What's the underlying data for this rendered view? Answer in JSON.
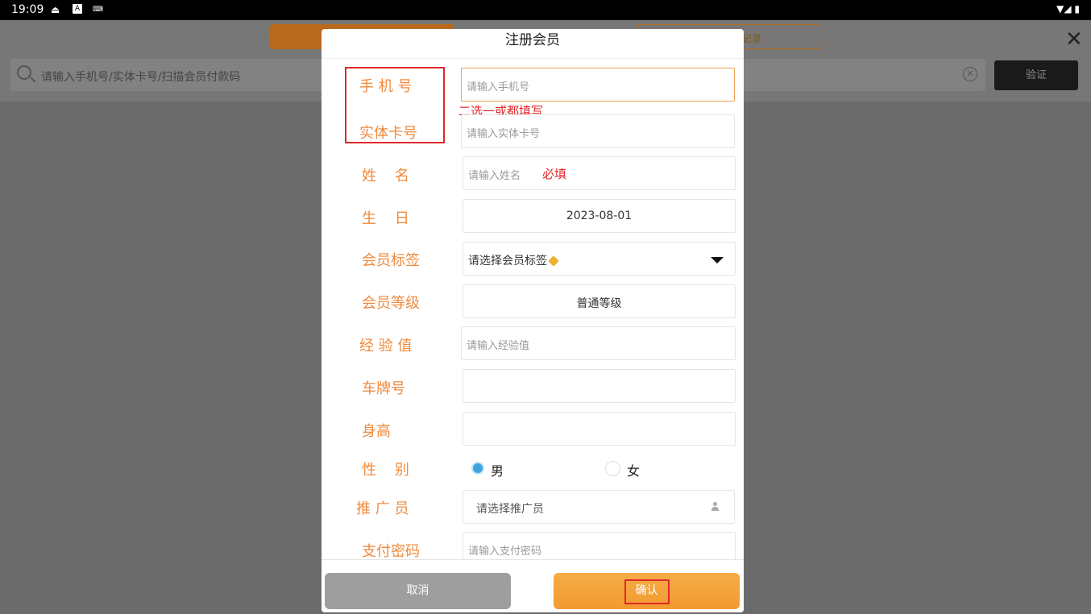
{
  "status_bar": {
    "time": "19:09"
  },
  "background": {
    "search_placeholder": "请输入手机号/实体卡号/扫描会员付款码",
    "verify_label": "验证",
    "tab_partial": "记录",
    "close_glyph": "✕",
    "clear_glyph": "✕"
  },
  "dialog": {
    "title": "注册会员",
    "fields": {
      "phone": {
        "label": "手 机 号",
        "placeholder": "请输入手机号"
      },
      "card": {
        "label": "实体卡号",
        "placeholder": "请输入实体卡号"
      },
      "name": {
        "label": "姓    名",
        "placeholder": "请输入姓名"
      },
      "birthday": {
        "label": "生    日",
        "value": "2023-08-01"
      },
      "tag": {
        "label": "会员标签",
        "placeholder": "请选择会员标签"
      },
      "level": {
        "label": "会员等级",
        "value": "普通等级"
      },
      "exp": {
        "label": "经 验 值",
        "placeholder": "请输入经验值"
      },
      "plate": {
        "label": "车牌号",
        "value": ""
      },
      "height": {
        "label": "身高",
        "value": ""
      },
      "gender": {
        "label": "性    别",
        "options": [
          "男",
          "女"
        ],
        "selected": "男"
      },
      "promoter": {
        "label": "推 广 员",
        "placeholder": "请选择推广员"
      },
      "pay_password": {
        "label": "支付密码",
        "placeholder": "请输入支付密码"
      }
    },
    "annotations": {
      "either_or": "二选一或都填写",
      "required": "必填"
    },
    "buttons": {
      "cancel": "取消",
      "confirm": "确认"
    }
  },
  "colors": {
    "accent": "#f29a30",
    "label": "#f08a3c",
    "annotation": "#e0282a",
    "radio": "#3ea4e0"
  },
  "icons": [
    "search-icon",
    "clear-icon",
    "close-icon",
    "dropdown-arrow-icon",
    "tag-icon",
    "person-icon",
    "wifi-icon",
    "battery-icon"
  ]
}
